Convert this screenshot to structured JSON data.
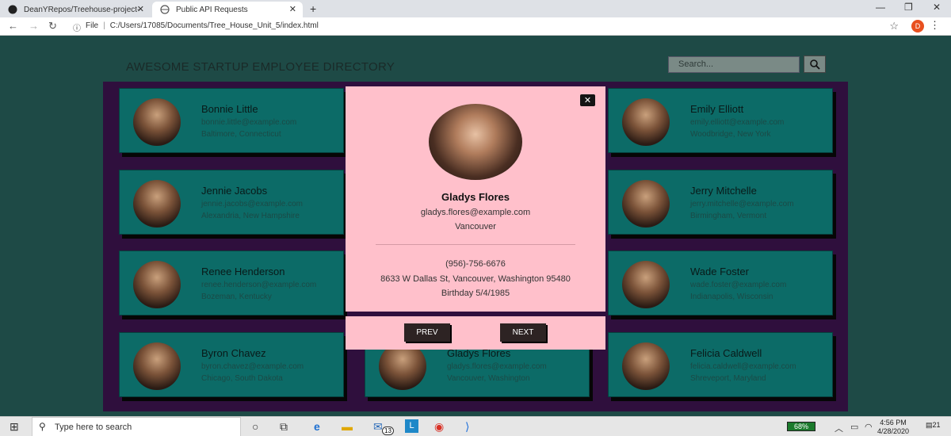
{
  "browser": {
    "tabs": [
      {
        "title": "DeanYRepos/Treehouse-project-"
      },
      {
        "title": "Public API Requests"
      }
    ],
    "url_scheme": "File",
    "url": "C:/Users/17085/Documents/Tree_House_Unit_5/index.html",
    "profile_initial": "D"
  },
  "header": {
    "title": "AWESOME STARTUP EMPLOYEE DIRECTORY",
    "search_placeholder": "Search..."
  },
  "employees": [
    {
      "name": "Bonnie Little",
      "email": "bonnie.little@example.com",
      "location": "Baltimore, Connecticut"
    },
    {
      "name": "Emily Elliott",
      "email": "emily.elliott@example.com",
      "location": "Woodbridge, New York"
    },
    {
      "name": "Jennie Jacobs",
      "email": "jennie.jacobs@example.com",
      "location": "Alexandria, New Hampshire"
    },
    {
      "name": "Jerry Mitchelle",
      "email": "jerry.mitchelle@example.com",
      "location": "Birmingham, Vermont"
    },
    {
      "name": "Renee Henderson",
      "email": "renee.henderson@example.com",
      "location": "Bozeman, Kentucky"
    },
    {
      "name": "Wade Foster",
      "email": "wade.foster@example.com",
      "location": "Indianapolis, Wisconsin"
    },
    {
      "name": "Byron Chavez",
      "email": "byron.chavez@example.com",
      "location": "Chicago, South Dakota"
    },
    {
      "name": "Gladys Flores",
      "email": "gladys.flores@example.com",
      "location": "Vancouver, Washington"
    },
    {
      "name": "Felicia Caldwell",
      "email": "felicia.caldwell@example.com",
      "location": "Shreveport, Maryland"
    }
  ],
  "modal": {
    "close_label": "✕",
    "name": "Gladys Flores",
    "email": "gladys.flores@example.com",
    "city": "Vancouver",
    "phone": "(956)-756-6676",
    "address": "8633 W Dallas St, Vancouver, Washington 95480",
    "birthday": "Birthday 5/4/1985",
    "prev_label": "PREV",
    "next_label": "NEXT"
  },
  "taskbar": {
    "search_placeholder": "Type here to search",
    "mail_badge": "13",
    "battery": "68%",
    "time": "4:56 PM",
    "date": "4/28/2020",
    "notifications": "21"
  },
  "colors": {
    "page_bg": "#1e4a46",
    "gallery_bg": "#2f0f3d",
    "card_bg": "#0c6b67",
    "modal_bg": "#ffc0cb"
  }
}
